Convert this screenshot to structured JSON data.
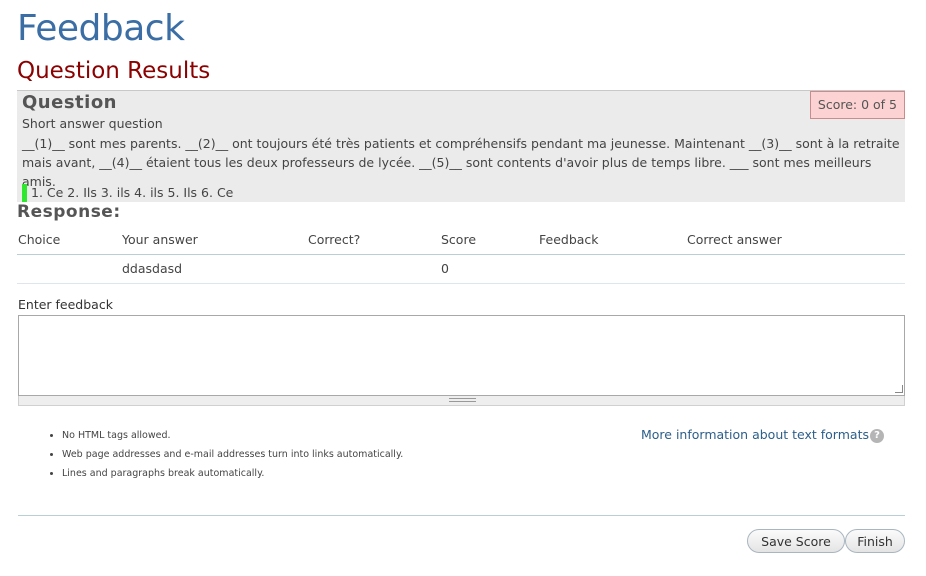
{
  "page": {
    "title": "Feedback",
    "section_title": "Question Results"
  },
  "question": {
    "heading": "Question",
    "score_label": "Score: 0 of 5",
    "type": "Short answer question",
    "text": "__(1)__ sont mes parents. __(2)__ ont toujours été très patients et compréhensifs pendant ma jeunesse. Maintenant __(3)__ sont à la retraite mais avant, __(4)__ étaient tous les deux professeurs de lycée. __(5)__ sont contents d'avoir plus de temps libre. ___ sont mes meilleurs amis.",
    "answer_key": "1. Ce 2. Ils 3. ils 4. ils 5. Ils 6. Ce",
    "answer_key_color": "#2ee82e"
  },
  "response": {
    "heading": "Response:",
    "columns": [
      "Choice",
      "Your answer",
      "Correct?",
      "Score",
      "Feedback",
      "Correct answer"
    ],
    "rows": [
      {
        "choice": "",
        "your_answer": "ddasdasd",
        "correct": "",
        "score": "0",
        "feedback": "",
        "correct_answer": ""
      }
    ]
  },
  "feedback": {
    "label": "Enter feedback",
    "value": ""
  },
  "formats": {
    "tips": [
      "No HTML tags allowed.",
      "Web page addresses and e-mail addresses turn into links automatically.",
      "Lines and paragraphs break automatically."
    ],
    "more_info_link": "More information about text formats",
    "help_icon": "?"
  },
  "actions": {
    "save_label": "Save Score",
    "finish_label": "Finish"
  },
  "colors": {
    "title": "#3b6ea5",
    "section_title": "#8b0000",
    "score_badge_bg": "#fcd2d2",
    "link": "#2c5f8a"
  }
}
